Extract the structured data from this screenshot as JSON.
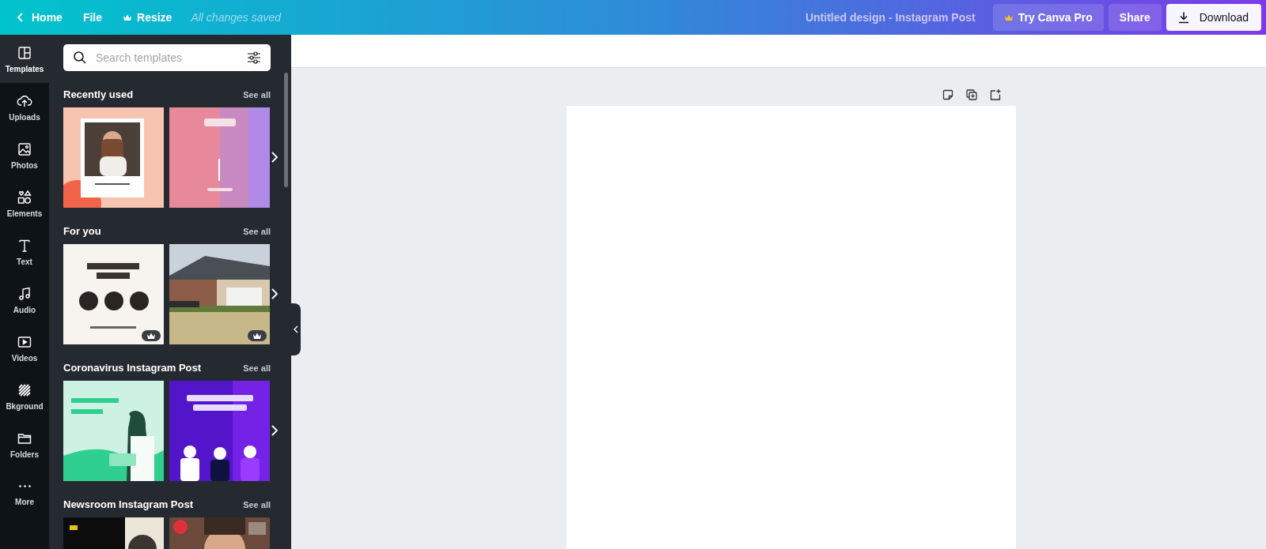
{
  "topbar": {
    "back_label": "Home",
    "menu": [
      {
        "label": "File",
        "crown": false
      },
      {
        "label": "Resize",
        "crown": true
      }
    ],
    "status": "All changes saved",
    "title": "Untitled design - Instagram Post",
    "try_pro": "Try Canva Pro",
    "share": "Share",
    "download": "Download"
  },
  "nav": [
    {
      "label": "Templates",
      "selected": true
    },
    {
      "label": "Uploads",
      "selected": false
    },
    {
      "label": "Photos",
      "selected": false
    },
    {
      "label": "Elements",
      "selected": false
    },
    {
      "label": "Text",
      "selected": false
    },
    {
      "label": "Audio",
      "selected": false
    },
    {
      "label": "Videos",
      "selected": false
    },
    {
      "label": "Bkground",
      "selected": false
    },
    {
      "label": "Folders",
      "selected": false
    },
    {
      "label": "More",
      "selected": false
    }
  ],
  "search": {
    "placeholder": "Search templates"
  },
  "sections": [
    {
      "title": "Recently used",
      "see_all": "See all",
      "next_arrow": true,
      "templates": [
        {
          "kind": "picture",
          "pro": false
        },
        {
          "kind": "picture",
          "pro": false
        }
      ]
    },
    {
      "title": "For you",
      "see_all": "See all",
      "next_arrow": true,
      "templates": [
        {
          "kind": "picture",
          "pro": true
        },
        {
          "kind": "picture",
          "pro": true
        }
      ]
    },
    {
      "title": "Coronavirus Instagram Post",
      "see_all": "See all",
      "next_arrow": true,
      "templates": [
        {
          "kind": "picture",
          "pro": false
        },
        {
          "kind": "picture",
          "pro": false
        }
      ]
    },
    {
      "title": "Newsroom Instagram Post",
      "see_all": "See all",
      "templates": [
        {
          "kind": "picture"
        },
        {
          "kind": "picture"
        }
      ]
    }
  ]
}
